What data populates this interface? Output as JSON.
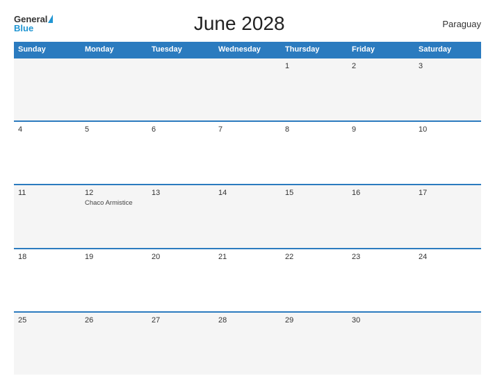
{
  "header": {
    "title": "June 2028",
    "country": "Paraguay",
    "logo": {
      "general": "General",
      "blue": "Blue"
    }
  },
  "calendar": {
    "days_of_week": [
      "Sunday",
      "Monday",
      "Tuesday",
      "Wednesday",
      "Thursday",
      "Friday",
      "Saturday"
    ],
    "weeks": [
      [
        {
          "number": "",
          "event": ""
        },
        {
          "number": "",
          "event": ""
        },
        {
          "number": "",
          "event": ""
        },
        {
          "number": "",
          "event": ""
        },
        {
          "number": "1",
          "event": ""
        },
        {
          "number": "2",
          "event": ""
        },
        {
          "number": "3",
          "event": ""
        }
      ],
      [
        {
          "number": "4",
          "event": ""
        },
        {
          "number": "5",
          "event": ""
        },
        {
          "number": "6",
          "event": ""
        },
        {
          "number": "7",
          "event": ""
        },
        {
          "number": "8",
          "event": ""
        },
        {
          "number": "9",
          "event": ""
        },
        {
          "number": "10",
          "event": ""
        }
      ],
      [
        {
          "number": "11",
          "event": ""
        },
        {
          "number": "12",
          "event": "Chaco Armistice"
        },
        {
          "number": "13",
          "event": ""
        },
        {
          "number": "14",
          "event": ""
        },
        {
          "number": "15",
          "event": ""
        },
        {
          "number": "16",
          "event": ""
        },
        {
          "number": "17",
          "event": ""
        }
      ],
      [
        {
          "number": "18",
          "event": ""
        },
        {
          "number": "19",
          "event": ""
        },
        {
          "number": "20",
          "event": ""
        },
        {
          "number": "21",
          "event": ""
        },
        {
          "number": "22",
          "event": ""
        },
        {
          "number": "23",
          "event": ""
        },
        {
          "number": "24",
          "event": ""
        }
      ],
      [
        {
          "number": "25",
          "event": ""
        },
        {
          "number": "26",
          "event": ""
        },
        {
          "number": "27",
          "event": ""
        },
        {
          "number": "28",
          "event": ""
        },
        {
          "number": "29",
          "event": ""
        },
        {
          "number": "30",
          "event": ""
        },
        {
          "number": "",
          "event": ""
        }
      ]
    ]
  }
}
